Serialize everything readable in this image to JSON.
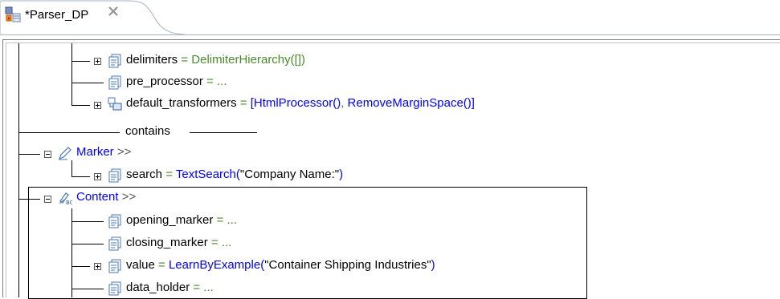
{
  "tab": {
    "title": "*Parser_DP",
    "close_icon": "close-icon"
  },
  "tree": {
    "delimiters": {
      "key": "delimiters",
      "eq": " = ",
      "value": "DelimiterHierarchy([])"
    },
    "pre_processor": {
      "key": "pre_processor",
      "eq": " = ..."
    },
    "default_transformers": {
      "key": "default_transformers",
      "eq": " = ",
      "v1": "[HtmlProcessor()",
      "sep": ", ",
      "v2": "RemoveMarginSpace()]"
    },
    "contains": "contains",
    "marker": {
      "label": "Marker",
      "more": ">>"
    },
    "search": {
      "key": "search",
      "eq": " = ",
      "fn": "TextSearch(",
      "arg": "\"Company Name:\"",
      "close": ")"
    },
    "content": {
      "label": "Content",
      "more": ">>"
    },
    "opening_marker": {
      "key": "opening_marker",
      "eq": " = ..."
    },
    "closing_marker": {
      "key": "closing_marker",
      "eq": " = ..."
    },
    "value": {
      "key": "value",
      "eq": " = ",
      "fn": "LearnByExample(",
      "arg": "\"Container Shipping Industries\"",
      "close": ")"
    },
    "data_holder": {
      "key": "data_holder",
      "eq": " = ..."
    }
  },
  "colors": {
    "link": "#0000ff",
    "equals": "#4a8a2a",
    "tab_border": "#a6b2c2"
  }
}
